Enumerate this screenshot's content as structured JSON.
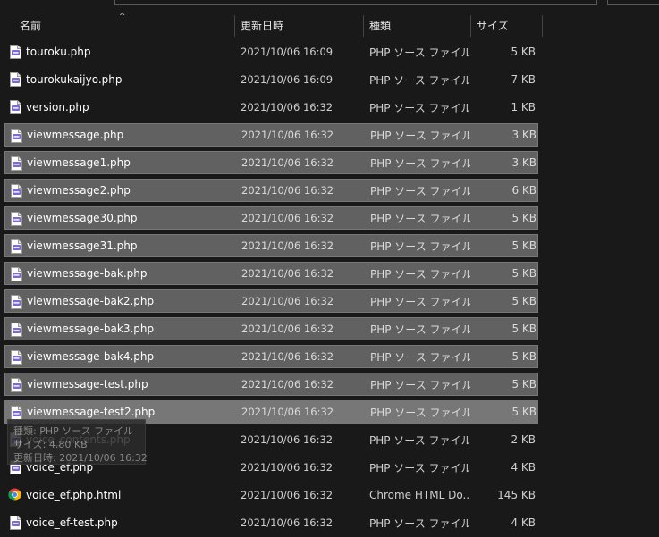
{
  "columns": {
    "name": "名前",
    "date": "更新日時",
    "type": "種類",
    "size": "サイズ"
  },
  "sort_indicator": "^",
  "rows": [
    {
      "name": "touroku.php",
      "date": "2021/10/06 16:09",
      "type": "PHP ソース ファイル",
      "size": "5 KB",
      "selected": false,
      "icon": "php-file-icon"
    },
    {
      "name": "tourokukaijyo.php",
      "date": "2021/10/06 16:09",
      "type": "PHP ソース ファイル",
      "size": "7 KB",
      "selected": false,
      "icon": "php-file-icon"
    },
    {
      "name": "version.php",
      "date": "2021/10/06 16:32",
      "type": "PHP ソース ファイル",
      "size": "1 KB",
      "selected": false,
      "icon": "php-file-icon"
    },
    {
      "name": "viewmessage.php",
      "date": "2021/10/06 16:32",
      "type": "PHP ソース ファイル",
      "size": "3 KB",
      "selected": true,
      "icon": "php-file-icon"
    },
    {
      "name": "viewmessage1.php",
      "date": "2021/10/06 16:32",
      "type": "PHP ソース ファイル",
      "size": "3 KB",
      "selected": true,
      "icon": "php-file-icon"
    },
    {
      "name": "viewmessage2.php",
      "date": "2021/10/06 16:32",
      "type": "PHP ソース ファイル",
      "size": "6 KB",
      "selected": true,
      "icon": "php-file-icon"
    },
    {
      "name": "viewmessage30.php",
      "date": "2021/10/06 16:32",
      "type": "PHP ソース ファイル",
      "size": "5 KB",
      "selected": true,
      "icon": "php-file-icon"
    },
    {
      "name": "viewmessage31.php",
      "date": "2021/10/06 16:32",
      "type": "PHP ソース ファイル",
      "size": "5 KB",
      "selected": true,
      "icon": "php-file-icon"
    },
    {
      "name": "viewmessage-bak.php",
      "date": "2021/10/06 16:32",
      "type": "PHP ソース ファイル",
      "size": "5 KB",
      "selected": true,
      "icon": "php-file-icon"
    },
    {
      "name": "viewmessage-bak2.php",
      "date": "2021/10/06 16:32",
      "type": "PHP ソース ファイル",
      "size": "5 KB",
      "selected": true,
      "icon": "php-file-icon"
    },
    {
      "name": "viewmessage-bak3.php",
      "date": "2021/10/06 16:32",
      "type": "PHP ソース ファイル",
      "size": "5 KB",
      "selected": true,
      "icon": "php-file-icon"
    },
    {
      "name": "viewmessage-bak4.php",
      "date": "2021/10/06 16:32",
      "type": "PHP ソース ファイル",
      "size": "5 KB",
      "selected": true,
      "icon": "php-file-icon"
    },
    {
      "name": "viewmessage-test.php",
      "date": "2021/10/06 16:32",
      "type": "PHP ソース ファイル",
      "size": "5 KB",
      "selected": true,
      "icon": "php-file-icon"
    },
    {
      "name": "viewmessage-test2.php",
      "date": "2021/10/06 16:32",
      "type": "PHP ソース ファイル",
      "size": "5 KB",
      "selected": true,
      "icon": "php-file-icon"
    },
    {
      "name": "voice_contents.php",
      "date": "2021/10/06 16:32",
      "type": "PHP ソース ファイル",
      "size": "2 KB",
      "selected": false,
      "icon": "php-file-icon"
    },
    {
      "name": "voice_ef.php",
      "date": "2021/10/06 16:32",
      "type": "PHP ソース ファイル",
      "size": "4 KB",
      "selected": false,
      "icon": "php-file-icon"
    },
    {
      "name": "voice_ef.php.html",
      "date": "2021/10/06 16:32",
      "type": "Chrome HTML Do...",
      "size": "145 KB",
      "selected": false,
      "icon": "chrome-icon"
    },
    {
      "name": "voice_ef-test.php",
      "date": "2021/10/06 16:32",
      "type": "PHP ソース ファイル",
      "size": "4 KB",
      "selected": false,
      "icon": "php-file-icon"
    }
  ],
  "tooltip": {
    "line1": "種類: PHP ソース ファイル",
    "line2": "サイズ: 4.80 KB",
    "line3": "更新日時: 2021/10/06 16:32"
  },
  "colors": {
    "background": "#191919",
    "selection": "#616161",
    "php_icon": "#7b6bd8",
    "text": "#ffffff"
  }
}
